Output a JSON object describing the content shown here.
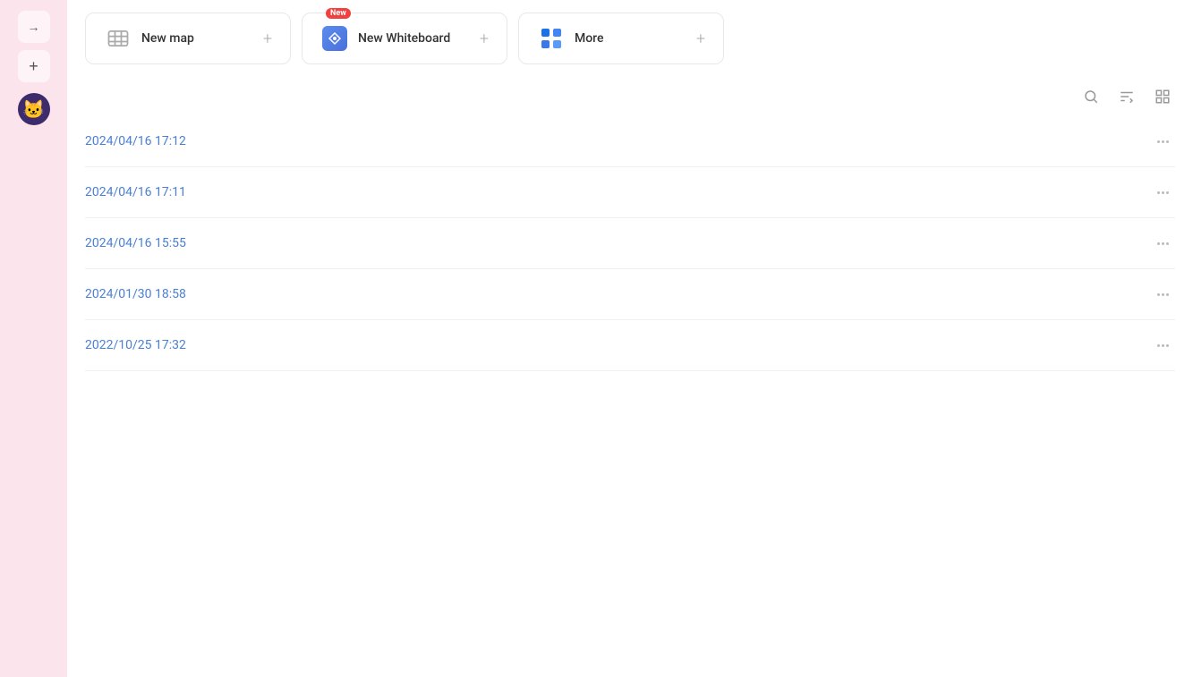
{
  "sidebar": {
    "nav_arrow": "→",
    "add_label": "+",
    "avatar_emoji": "🐱"
  },
  "quick_actions": {
    "new_map": {
      "label": "New map",
      "icon_type": "map",
      "plus": "+"
    },
    "new_whiteboard": {
      "label": "New Whiteboard",
      "badge": "New",
      "icon_type": "whiteboard",
      "plus": "+"
    },
    "more": {
      "label": "More",
      "icon_type": "grid",
      "plus": "+"
    }
  },
  "toolbar": {
    "search_icon": "search",
    "sort_icon": "sort",
    "layout_icon": "layout"
  },
  "list": {
    "items": [
      {
        "date": "2024/04/16 17:12"
      },
      {
        "date": "2024/04/16 17:11"
      },
      {
        "date": "2024/04/16 15:55"
      },
      {
        "date": "2024/01/30 18:58"
      },
      {
        "date": "2022/10/25 17:32"
      }
    ]
  }
}
